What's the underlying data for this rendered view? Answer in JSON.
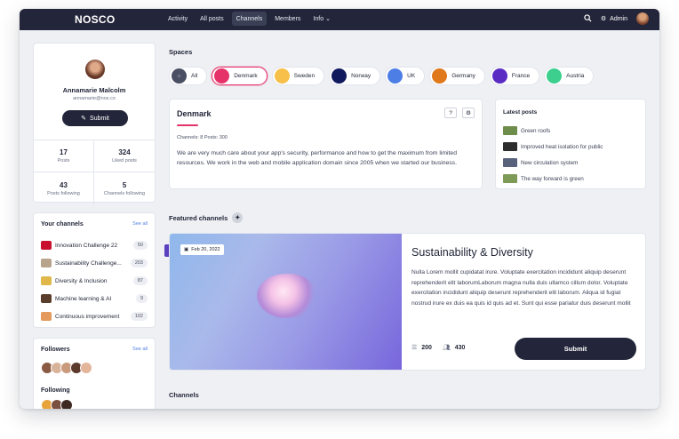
{
  "nav": {
    "brand": "NOSCO",
    "links": [
      "Activity",
      "All posts",
      "Channels",
      "Members",
      "Info"
    ],
    "active": "Channels",
    "admin_label": "Admin"
  },
  "profile": {
    "name": "Annamarie Malcolm",
    "email": "annamarie@nos.co",
    "submit_label": "Submit",
    "stats": [
      {
        "num": "17",
        "label": "Posts"
      },
      {
        "num": "324",
        "label": "Liked posts"
      },
      {
        "num": "43",
        "label": "Posts following"
      },
      {
        "num": "5",
        "label": "Channels following"
      }
    ]
  },
  "your_channels": {
    "title": "Your channels",
    "see_all": "See all",
    "items": [
      {
        "name": "Innovation Challenge 22",
        "count": "50",
        "color": "#c8102e"
      },
      {
        "name": "Sustainability Challenge...",
        "count": "203",
        "color": "#b8a38c"
      },
      {
        "name": "Diversity & Inclusion",
        "count": "87",
        "color": "#e0b84a"
      },
      {
        "name": "Machine learning & AI",
        "count": "9",
        "color": "#5a3d2b"
      },
      {
        "name": "Continuous improvement",
        "count": "102",
        "color": "#e39a5c"
      }
    ]
  },
  "followers": {
    "title": "Followers",
    "see_all": "See all",
    "following_label": "Following"
  },
  "spaces": {
    "title": "Spaces",
    "chips": [
      {
        "label": "All",
        "color": "#4b4f63"
      },
      {
        "label": "Denmark",
        "color": "#e5336a"
      },
      {
        "label": "Sweden",
        "color": "#f7c04a"
      },
      {
        "label": "Norway",
        "color": "#101a5c"
      },
      {
        "label": "UK",
        "color": "#4d7ee6"
      },
      {
        "label": "Germany",
        "color": "#e0781c"
      },
      {
        "label": "France",
        "color": "#5a2cc4"
      },
      {
        "label": "Austria",
        "color": "#3ccf8e"
      }
    ]
  },
  "space_card": {
    "title": "Denmark",
    "meta": "Channels: 8   Posts: 300",
    "description": "We are very much care about your app's security, performance and how to get the maximum from limited resources. We work in the web and mobile application domain since 2005 when we started our business."
  },
  "latest_posts": {
    "title": "Latest posts",
    "items": [
      {
        "label": "Green roofs",
        "color": "#6f8d4a"
      },
      {
        "label": "Improved heat isolation for public",
        "color": "#2d2d2d"
      },
      {
        "label": "New circulation system",
        "color": "#58627a"
      },
      {
        "label": "The way forward is green",
        "color": "#7d9a56"
      }
    ]
  },
  "featured": {
    "heading": "Featured channels",
    "date": "Feb 20, 2022",
    "title": "Sustainability & Diversity",
    "description": "Nulla Lorem mollit cupidatat irure. Voluptate exercitation incididunt aliquip deserunt reprehenderit elit laborumLaborum magna nulla duis ullamco cillum dolor. Voluptate exercitation incididunt aliquip deserunt reprehenderit elit laborum. Aliqua id fugiat nostrud irure ex duis ea quis id quis ad et. Sunt qui esse pariatur duis deserunt mollit",
    "posts": "200",
    "members": "430",
    "submit_label": "Submit"
  },
  "channels_heading": "Channels"
}
